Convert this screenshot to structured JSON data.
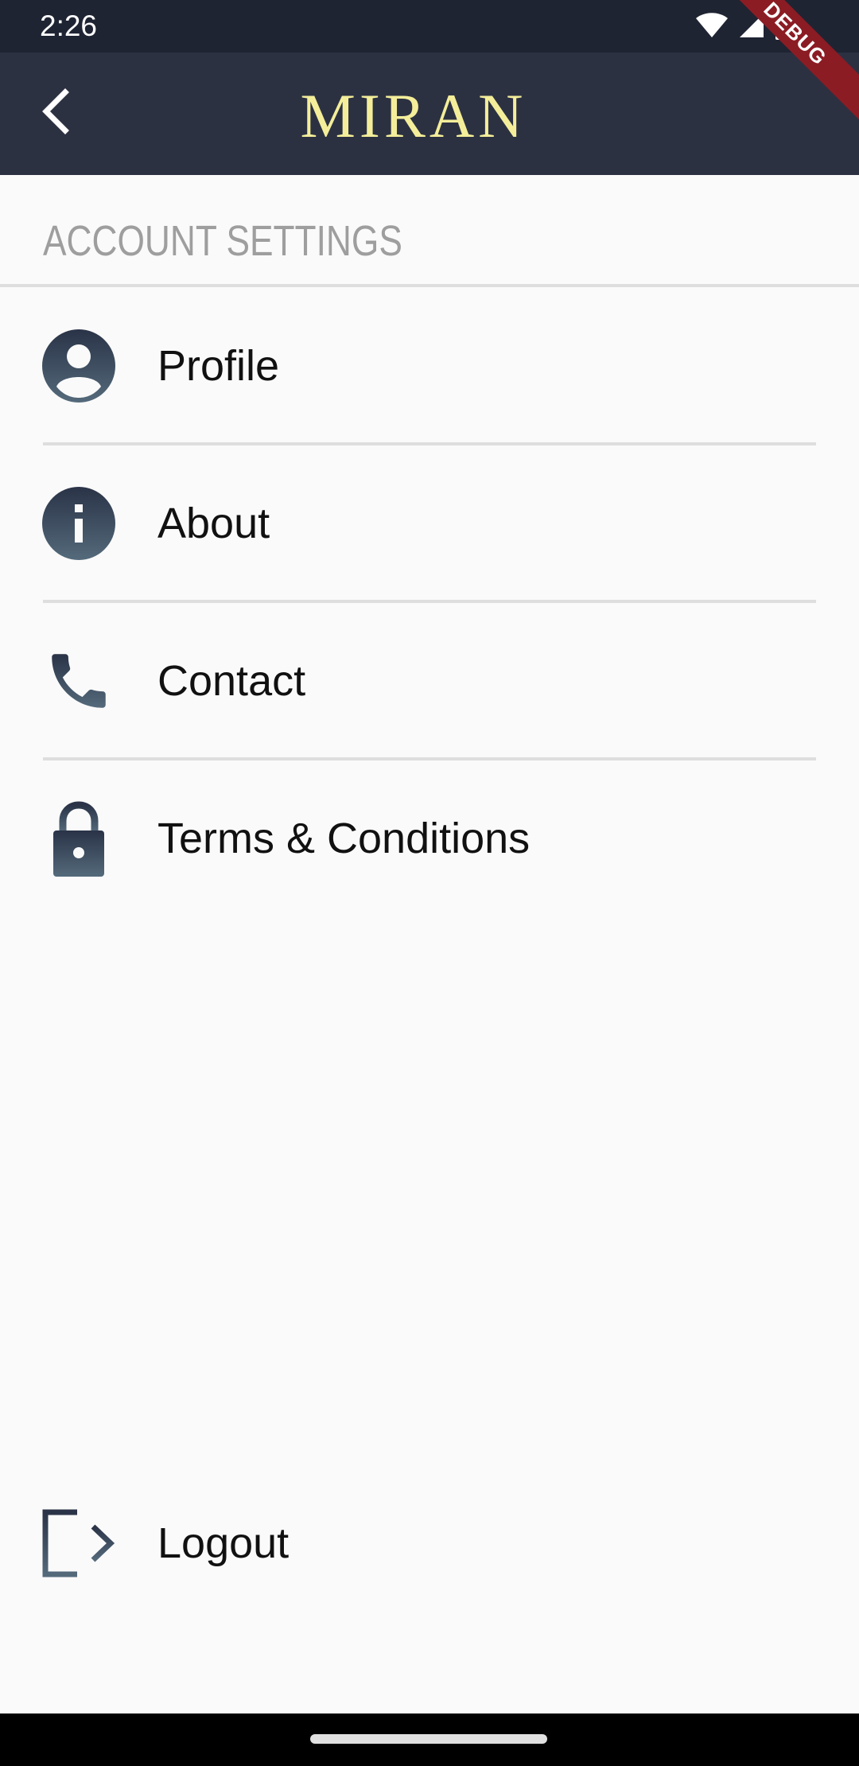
{
  "status_bar": {
    "time": "2:26",
    "icons": [
      "wifi-icon",
      "cellular-signal-icon",
      "battery-icon"
    ]
  },
  "app_bar": {
    "title": "MIRAN",
    "back_icon": "chevron-left-icon",
    "title_color": "#f4ee9a",
    "background": "#2c3142"
  },
  "debug_banner": {
    "label": "DEBUG",
    "color": "#8b1c24"
  },
  "section": {
    "title": "ACCOUNT SETTINGS"
  },
  "menu": {
    "items": [
      {
        "label": "Profile",
        "icon": "account-circle-icon"
      },
      {
        "label": "About",
        "icon": "info-icon"
      },
      {
        "label": "Contact",
        "icon": "phone-icon"
      },
      {
        "label": "Terms & Conditions",
        "icon": "lock-icon"
      }
    ],
    "icon_gradient": [
      "#2a3347",
      "#546a7b"
    ]
  },
  "logout": {
    "label": "Logout",
    "icon": "logout-icon"
  }
}
